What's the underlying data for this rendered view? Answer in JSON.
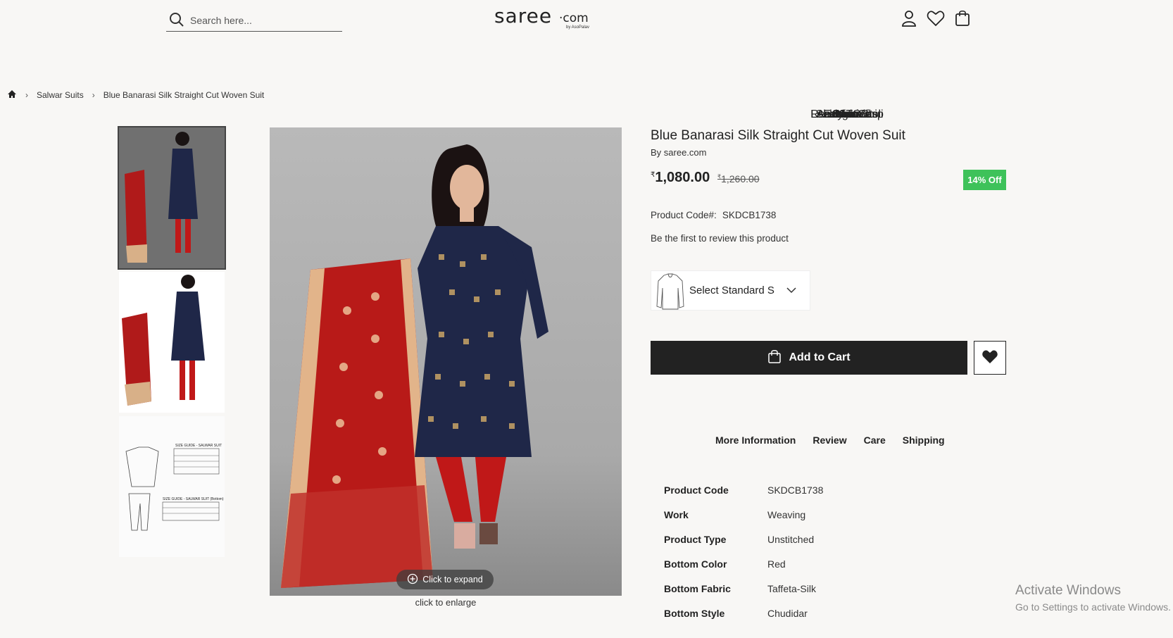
{
  "header": {
    "search_placeholder": "Search here...",
    "logo_main": "saree",
    "logo_suffix": "·com",
    "logo_by": "by AsoPalav"
  },
  "nav": [
    {
      "label": "New",
      "accent": false
    },
    {
      "label": "Exclusive",
      "accent": false
    },
    {
      "label": "Saree",
      "accent": false
    },
    {
      "label": "Salwar Suits",
      "accent": false
    },
    {
      "label": "Lehenga Choli",
      "accent": false
    },
    {
      "label": "Kurti",
      "accent": false
    },
    {
      "label": "Gown",
      "accent": false
    },
    {
      "label": "Kids",
      "accent": false
    },
    {
      "label": "Men",
      "accent": false
    },
    {
      "label": "Accessories",
      "accent": false
    },
    {
      "label": "Ready To Ship",
      "accent": true
    }
  ],
  "breadcrumb": {
    "category": "Salwar Suits",
    "current": "Blue Banarasi Silk Straight Cut Woven Suit"
  },
  "gallery": {
    "expand_label": "Click to expand",
    "enlarge_label": "click to enlarge",
    "size_guide_top": "SIZE GUIDE - SALWAR SUIT",
    "size_guide_bottom": "SIZE GUIDE - SALWAR SUIT (Bottom)"
  },
  "product": {
    "title": "Blue Banarasi Silk Straight Cut Woven Suit",
    "byline": "By saree.com",
    "currency": "₹",
    "price": "1,080.00",
    "old_price": "1,260.00",
    "discount": "14% Off",
    "code_label": "Product Code#:",
    "code_value": "SKDCB1738",
    "review_link": "Be the first to review this product",
    "size_select": "Select Standard S",
    "add_to_cart": "Add to Cart"
  },
  "tabs": [
    "More Information",
    "Review",
    "Care",
    "Shipping"
  ],
  "specs": [
    {
      "k": "Product Code",
      "v": "SKDCB1738"
    },
    {
      "k": "Work",
      "v": "Weaving"
    },
    {
      "k": "Product Type",
      "v": "Unstitched"
    },
    {
      "k": "Bottom Color",
      "v": "Red"
    },
    {
      "k": "Bottom Fabric",
      "v": "Taffeta-Silk"
    },
    {
      "k": "Bottom Style",
      "v": "Chudidar"
    }
  ],
  "watermark": {
    "line1": "Activate Windows",
    "line2": "Go to Settings to activate Windows."
  },
  "colors": {
    "accent": "#c2185b",
    "discount_bg": "#3ec25a",
    "cart_bg": "#222222",
    "page_bg": "#f8f7f5"
  }
}
